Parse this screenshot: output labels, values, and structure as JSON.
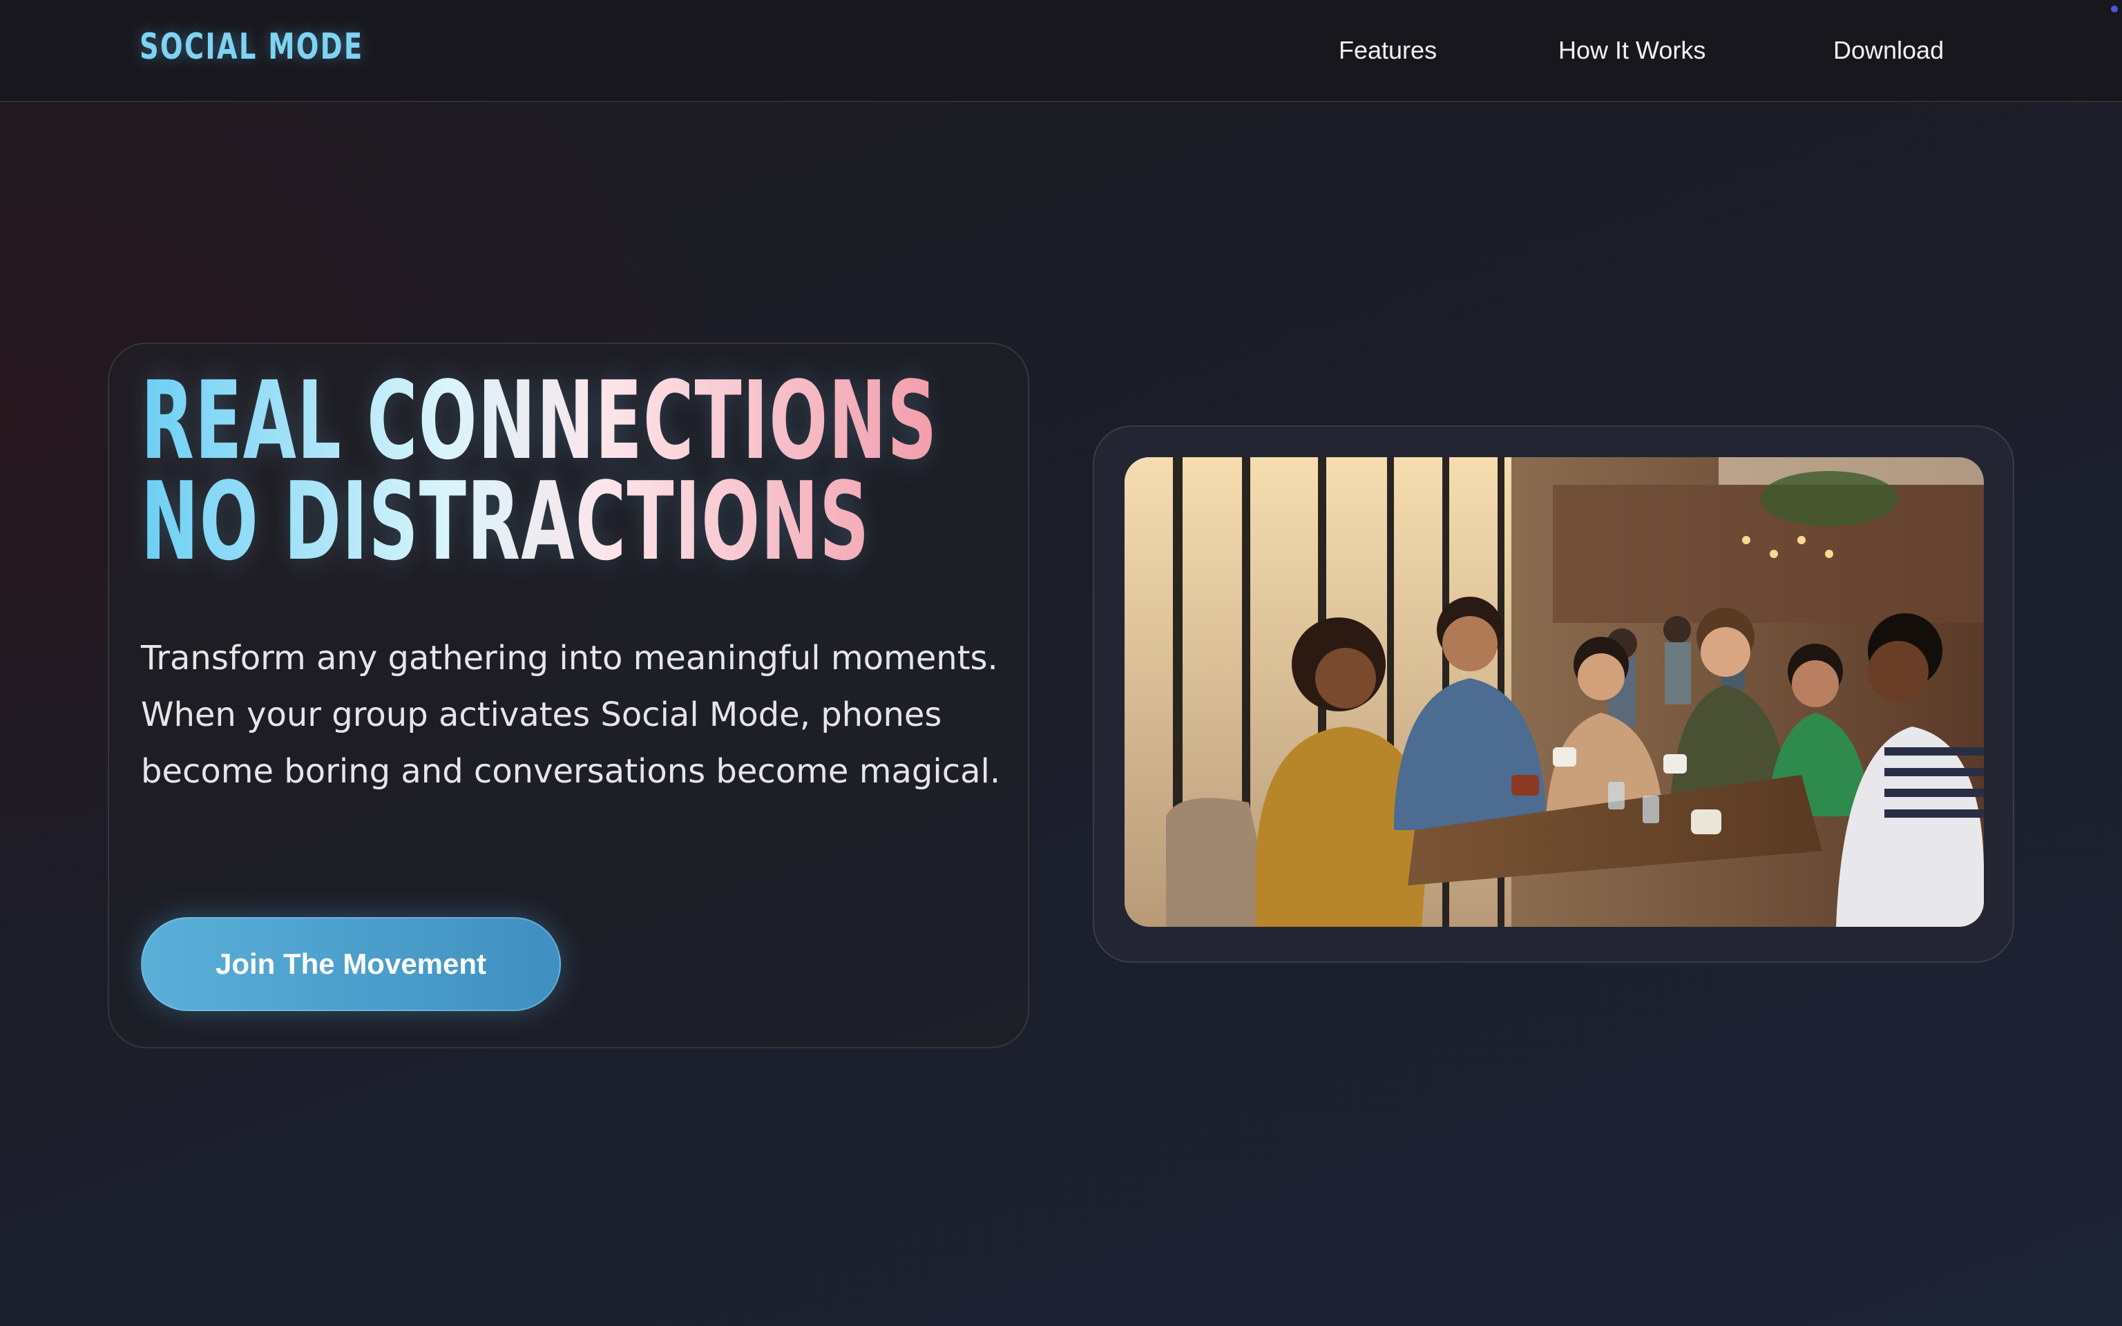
{
  "header": {
    "logo": "SOCIAL MODE",
    "nav": [
      {
        "label": "Features"
      },
      {
        "label": "How It Works"
      },
      {
        "label": "Download"
      }
    ]
  },
  "hero": {
    "headline_line1": "REAL CONNECTIONS",
    "headline_line2": "NO DISTRACTIONS",
    "description": "Transform any gathering into meaningful moments. When your group activates Social Mode, phones become boring and conversations become magical.",
    "cta_label": "Join The Movement"
  },
  "image": {
    "subject": "friends laughing around a cafe table"
  },
  "colors": {
    "accent_blue": "#6ccff4",
    "accent_pink": "#f29dac",
    "button": "#4a9fcf",
    "background": "#1c1d28"
  }
}
